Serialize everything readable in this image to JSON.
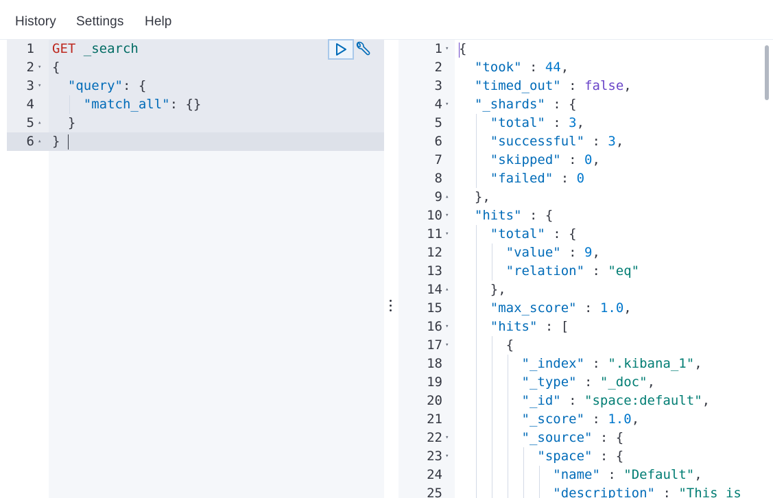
{
  "menu": [
    "History",
    "Settings",
    "Help"
  ],
  "request": {
    "lines": [
      {
        "n": "1",
        "fold": "",
        "indent": 0,
        "tokens": [
          {
            "t": "GET",
            "c": "tok-method"
          },
          {
            "t": " ",
            "c": "tok-punc"
          },
          {
            "t": "_search",
            "c": "tok-url"
          }
        ]
      },
      {
        "n": "2",
        "fold": "▾",
        "indent": 0,
        "tokens": [
          {
            "t": "{",
            "c": "tok-punc"
          }
        ]
      },
      {
        "n": "3",
        "fold": "▾",
        "indent": 1,
        "tokens": [
          {
            "t": "\"query\"",
            "c": "tok-key"
          },
          {
            "t": ": {",
            "c": "tok-punc"
          }
        ]
      },
      {
        "n": "4",
        "fold": "",
        "indent": 2,
        "tokens": [
          {
            "t": "\"match_all\"",
            "c": "tok-key"
          },
          {
            "t": ": {}",
            "c": "tok-punc"
          }
        ]
      },
      {
        "n": "5",
        "fold": "▴",
        "indent": 1,
        "tokens": [
          {
            "t": "}",
            "c": "tok-punc"
          }
        ]
      },
      {
        "n": "6",
        "fold": "▴",
        "indent": 0,
        "tokens": [
          {
            "t": "}",
            "c": "tok-punc"
          }
        ]
      }
    ]
  },
  "response": {
    "lines": [
      {
        "n": "1",
        "fold": "▾",
        "indent": 0,
        "tokens": [
          {
            "t": "{",
            "c": "tok-punc"
          }
        ]
      },
      {
        "n": "2",
        "fold": "",
        "indent": 1,
        "tokens": [
          {
            "t": "\"took\"",
            "c": "tok-key"
          },
          {
            "t": " : ",
            "c": "tok-punc"
          },
          {
            "t": "44",
            "c": "tok-num"
          },
          {
            "t": ",",
            "c": "tok-punc"
          }
        ]
      },
      {
        "n": "3",
        "fold": "",
        "indent": 1,
        "tokens": [
          {
            "t": "\"timed_out\"",
            "c": "tok-key"
          },
          {
            "t": " : ",
            "c": "tok-punc"
          },
          {
            "t": "false",
            "c": "tok-kw"
          },
          {
            "t": ",",
            "c": "tok-punc"
          }
        ]
      },
      {
        "n": "4",
        "fold": "▾",
        "indent": 1,
        "tokens": [
          {
            "t": "\"_shards\"",
            "c": "tok-key"
          },
          {
            "t": " : {",
            "c": "tok-punc"
          }
        ]
      },
      {
        "n": "5",
        "fold": "",
        "indent": 2,
        "tokens": [
          {
            "t": "\"total\"",
            "c": "tok-key"
          },
          {
            "t": " : ",
            "c": "tok-punc"
          },
          {
            "t": "3",
            "c": "tok-num"
          },
          {
            "t": ",",
            "c": "tok-punc"
          }
        ]
      },
      {
        "n": "6",
        "fold": "",
        "indent": 2,
        "tokens": [
          {
            "t": "\"successful\"",
            "c": "tok-key"
          },
          {
            "t": " : ",
            "c": "tok-punc"
          },
          {
            "t": "3",
            "c": "tok-num"
          },
          {
            "t": ",",
            "c": "tok-punc"
          }
        ]
      },
      {
        "n": "7",
        "fold": "",
        "indent": 2,
        "tokens": [
          {
            "t": "\"skipped\"",
            "c": "tok-key"
          },
          {
            "t": " : ",
            "c": "tok-punc"
          },
          {
            "t": "0",
            "c": "tok-num"
          },
          {
            "t": ",",
            "c": "tok-punc"
          }
        ]
      },
      {
        "n": "8",
        "fold": "",
        "indent": 2,
        "tokens": [
          {
            "t": "\"failed\"",
            "c": "tok-key"
          },
          {
            "t": " : ",
            "c": "tok-punc"
          },
          {
            "t": "0",
            "c": "tok-num"
          }
        ]
      },
      {
        "n": "9",
        "fold": "▴",
        "indent": 1,
        "tokens": [
          {
            "t": "},",
            "c": "tok-punc"
          }
        ]
      },
      {
        "n": "10",
        "fold": "▾",
        "indent": 1,
        "tokens": [
          {
            "t": "\"hits\"",
            "c": "tok-key"
          },
          {
            "t": " : {",
            "c": "tok-punc"
          }
        ]
      },
      {
        "n": "11",
        "fold": "▾",
        "indent": 2,
        "tokens": [
          {
            "t": "\"total\"",
            "c": "tok-key"
          },
          {
            "t": " : {",
            "c": "tok-punc"
          }
        ]
      },
      {
        "n": "12",
        "fold": "",
        "indent": 3,
        "tokens": [
          {
            "t": "\"value\"",
            "c": "tok-key"
          },
          {
            "t": " : ",
            "c": "tok-punc"
          },
          {
            "t": "9",
            "c": "tok-num"
          },
          {
            "t": ",",
            "c": "tok-punc"
          }
        ]
      },
      {
        "n": "13",
        "fold": "",
        "indent": 3,
        "tokens": [
          {
            "t": "\"relation\"",
            "c": "tok-key"
          },
          {
            "t": " : ",
            "c": "tok-punc"
          },
          {
            "t": "\"eq\"",
            "c": "tok-str"
          }
        ]
      },
      {
        "n": "14",
        "fold": "▴",
        "indent": 2,
        "tokens": [
          {
            "t": "},",
            "c": "tok-punc"
          }
        ]
      },
      {
        "n": "15",
        "fold": "",
        "indent": 2,
        "tokens": [
          {
            "t": "\"max_score\"",
            "c": "tok-key"
          },
          {
            "t": " : ",
            "c": "tok-punc"
          },
          {
            "t": "1.0",
            "c": "tok-num"
          },
          {
            "t": ",",
            "c": "tok-punc"
          }
        ]
      },
      {
        "n": "16",
        "fold": "▾",
        "indent": 2,
        "tokens": [
          {
            "t": "\"hits\"",
            "c": "tok-key"
          },
          {
            "t": " : [",
            "c": "tok-punc"
          }
        ]
      },
      {
        "n": "17",
        "fold": "▾",
        "indent": 3,
        "tokens": [
          {
            "t": "{",
            "c": "tok-punc"
          }
        ]
      },
      {
        "n": "18",
        "fold": "",
        "indent": 4,
        "tokens": [
          {
            "t": "\"_index\"",
            "c": "tok-key"
          },
          {
            "t": " : ",
            "c": "tok-punc"
          },
          {
            "t": "\".kibana_1\"",
            "c": "tok-str"
          },
          {
            "t": ",",
            "c": "tok-punc"
          }
        ]
      },
      {
        "n": "19",
        "fold": "",
        "indent": 4,
        "tokens": [
          {
            "t": "\"_type\"",
            "c": "tok-key"
          },
          {
            "t": " : ",
            "c": "tok-punc"
          },
          {
            "t": "\"_doc\"",
            "c": "tok-str"
          },
          {
            "t": ",",
            "c": "tok-punc"
          }
        ]
      },
      {
        "n": "20",
        "fold": "",
        "indent": 4,
        "tokens": [
          {
            "t": "\"_id\"",
            "c": "tok-key"
          },
          {
            "t": " : ",
            "c": "tok-punc"
          },
          {
            "t": "\"space:default\"",
            "c": "tok-str"
          },
          {
            "t": ",",
            "c": "tok-punc"
          }
        ]
      },
      {
        "n": "21",
        "fold": "",
        "indent": 4,
        "tokens": [
          {
            "t": "\"_score\"",
            "c": "tok-key"
          },
          {
            "t": " : ",
            "c": "tok-punc"
          },
          {
            "t": "1.0",
            "c": "tok-num"
          },
          {
            "t": ",",
            "c": "tok-punc"
          }
        ]
      },
      {
        "n": "22",
        "fold": "▾",
        "indent": 4,
        "tokens": [
          {
            "t": "\"_source\"",
            "c": "tok-key"
          },
          {
            "t": " : {",
            "c": "tok-punc"
          }
        ]
      },
      {
        "n": "23",
        "fold": "▾",
        "indent": 5,
        "tokens": [
          {
            "t": "\"space\"",
            "c": "tok-key"
          },
          {
            "t": " : {",
            "c": "tok-punc"
          }
        ]
      },
      {
        "n": "24",
        "fold": "",
        "indent": 6,
        "tokens": [
          {
            "t": "\"name\"",
            "c": "tok-key"
          },
          {
            "t": " : ",
            "c": "tok-punc"
          },
          {
            "t": "\"Default\"",
            "c": "tok-str"
          },
          {
            "t": ",",
            "c": "tok-punc"
          }
        ]
      },
      {
        "n": "25",
        "fold": "",
        "indent": 6,
        "tokens": [
          {
            "t": "\"description\"",
            "c": "tok-key"
          },
          {
            "t": " : ",
            "c": "tok-punc"
          },
          {
            "t": "\"This is",
            "c": "tok-str"
          }
        ]
      }
    ]
  },
  "icons": {
    "send_request": "play-icon",
    "request_options": "wrench-icon",
    "pane_resize": "drag-handle-icon"
  }
}
